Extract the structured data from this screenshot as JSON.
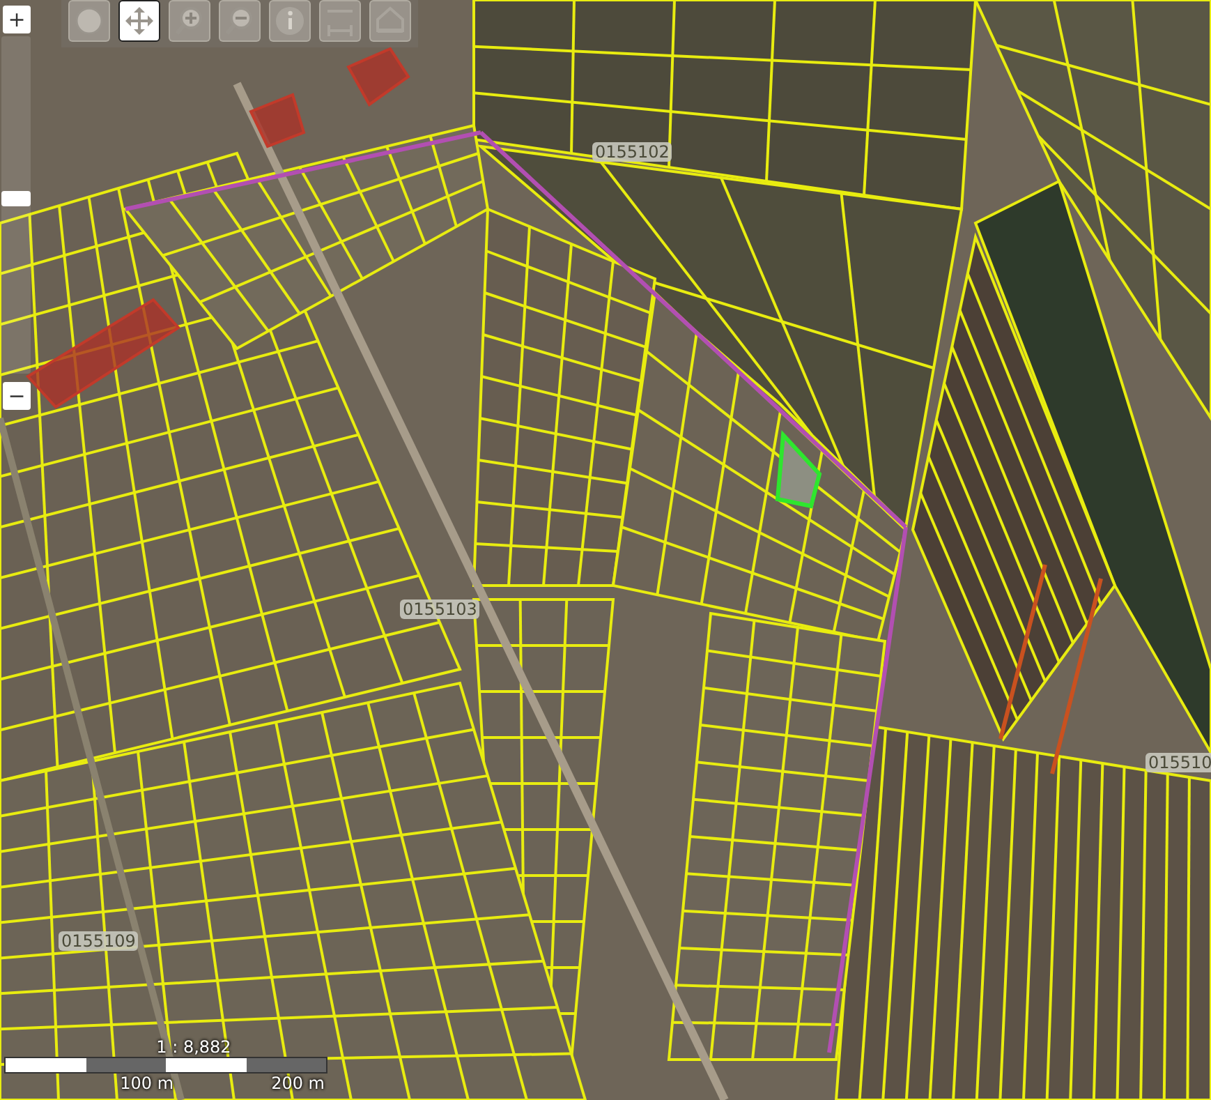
{
  "map": {
    "parcel_labels": [
      {
        "text": "0155102"
      },
      {
        "text": "0155103"
      },
      {
        "text": "015510"
      },
      {
        "text": "0155109"
      }
    ]
  },
  "zoom_controls": {
    "zoom_in": "+",
    "slider": {
      "level": 0.52
    },
    "zoom_out": "−"
  },
  "toolbar": {
    "tools": [
      {
        "kind": "globe",
        "selected": false
      },
      {
        "kind": "pan",
        "selected": true
      },
      {
        "kind": "zoom-in",
        "selected": false
      },
      {
        "kind": "zoom-out",
        "selected": false
      },
      {
        "kind": "info",
        "selected": false
      },
      {
        "kind": "measure",
        "selected": false
      },
      {
        "kind": "area",
        "selected": false
      }
    ]
  },
  "scale": {
    "ratio": "1 : 8,882",
    "labels": [
      "100 m",
      "200 m"
    ]
  }
}
